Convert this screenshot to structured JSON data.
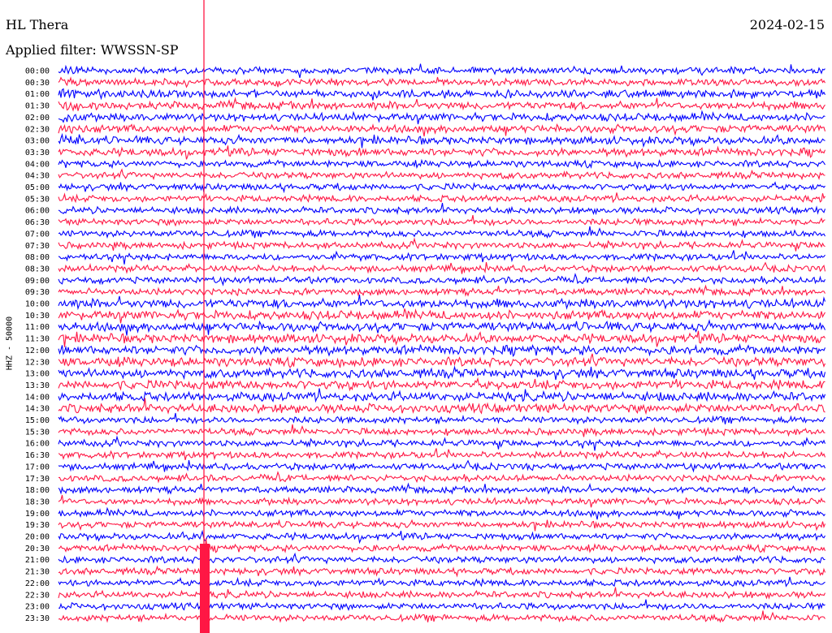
{
  "header": {
    "station": "HL Thera",
    "date": "2024-02-15",
    "filter": "Applied filter: WWSSN-SP"
  },
  "chart_data": {
    "type": "line",
    "title": "HL Thera",
    "date": "2024-02-15",
    "filter": "WWSSN-SP",
    "ylabel": "HHZ - 50000",
    "row_labels": [
      "00:00",
      "00:30",
      "01:00",
      "01:30",
      "02:00",
      "02:30",
      "03:00",
      "03:30",
      "04:00",
      "04:30",
      "05:00",
      "05:30",
      "06:00",
      "06:30",
      "07:00",
      "07:30",
      "08:00",
      "08:30",
      "09:00",
      "09:30",
      "10:00",
      "10:30",
      "11:00",
      "11:30",
      "12:00",
      "12:30",
      "13:00",
      "13:30",
      "14:00",
      "14:30",
      "15:00",
      "15:30",
      "16:00",
      "16:30",
      "17:00",
      "17:30",
      "18:00",
      "18:30",
      "19:00",
      "19:30",
      "20:00",
      "20:30",
      "21:00",
      "21:30",
      "22:00",
      "22:30",
      "23:00",
      "23:30"
    ],
    "row_label_text": [
      "00:00",
      "00:30",
      "01:00",
      "01:30",
      "02:00",
      "02:30",
      "03:00",
      "03:30",
      "04:00",
      "04:30",
      "05:00",
      "05:30",
      "06:00",
      "06:30",
      "07:00",
      "07:30",
      "08:00",
      "08:30",
      "09:00",
      "09:30",
      "10:00",
      "10:30",
      "11:00",
      "11:30",
      "12:00",
      "12:30",
      "13:00",
      "13:30",
      "14:00",
      "14:30",
      "15:00",
      "15:30",
      "16:00",
      "16:30",
      "17:00",
      "17:30",
      "18:00",
      "18:30",
      "19:00",
      "19:30",
      "20:00",
      "20:30",
      "21:00",
      "21:30",
      "22:00",
      "22:30",
      "23:00",
      "23:30"
    ],
    "trace_colors": [
      "#0000ff",
      "#ff1744"
    ],
    "event_time": "03:00 + ~4 min",
    "grid": false
  }
}
